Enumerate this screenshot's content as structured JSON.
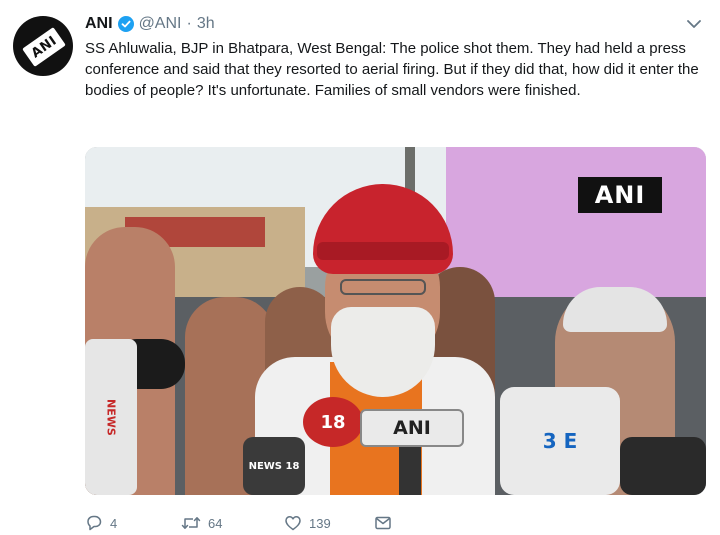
{
  "tweet": {
    "avatar": {
      "icon": "ani-logo-icon",
      "logo_text": "ANI"
    },
    "author_name": "ANI",
    "verified": true,
    "handle": "@ANI",
    "separator": "·",
    "time": "3h",
    "text": "SS Ahluwalia, BJP in Bhatpara, West Bengal: The police shot them. They had held a press conference and said that they resorted to aerial firing. But if they did that, how did it enter the bodies of people? It's unfortunate. Families of small vendors were finished.",
    "media": {
      "watermark": "ANI",
      "mic_labels": [
        "ANI",
        "18",
        "NEWS 18",
        "3 E",
        "NEWS"
      ]
    },
    "actions": {
      "reply_count": "4",
      "retweet_count": "64",
      "like_count": "139"
    }
  },
  "colors": {
    "text": "#14171a",
    "secondary": "#657786",
    "verified": "#1da1f2"
  }
}
